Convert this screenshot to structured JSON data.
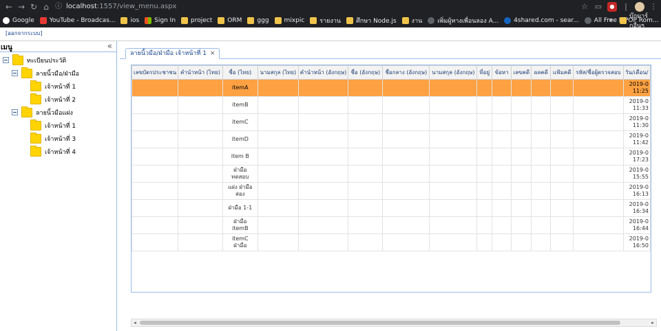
{
  "browser": {
    "url_host": "localhost",
    "url_path": ":1557/view_menu.aspx",
    "bookmarks": [
      {
        "label": "Google",
        "icon": "google-icon"
      },
      {
        "label": "YouTube - Broadcas...",
        "icon": "youtube-icon"
      },
      {
        "label": "ios",
        "icon": "folder-icon"
      },
      {
        "label": "Sign In",
        "icon": "microsoft-icon"
      },
      {
        "label": "project",
        "icon": "folder-icon"
      },
      {
        "label": "ORM",
        "icon": "folder-icon"
      },
      {
        "label": "ggg",
        "icon": "folder-icon"
      },
      {
        "label": "mixpic",
        "icon": "folder-icon"
      },
      {
        "label": "รายงาน",
        "icon": "folder-icon"
      },
      {
        "label": "ศึกษา Node.js",
        "icon": "folder-icon"
      },
      {
        "label": "งาน",
        "icon": "folder-icon"
      },
      {
        "label": "เพิ่มผู้ทางเพื่อนลอง A...",
        "icon": "globe-icon"
      },
      {
        "label": "4shared.com - sear...",
        "icon": "4shared-icon"
      },
      {
        "label": "All Free K-POP Rom...",
        "icon": "globe-icon"
      }
    ],
    "more": "»",
    "other_bookmarks": "บุ๊กมาร์กอื่นๆ"
  },
  "page": {
    "logout": "[ออกจากระบบ]",
    "west_title": "เมนู",
    "collapse": "«"
  },
  "tree": [
    {
      "label": "ทะเบียนประวัติ",
      "level": 0,
      "expander": true
    },
    {
      "label": "ลายนิ้วมือ/ฝ่ามือ",
      "level": 1,
      "expander": true
    },
    {
      "label": "เจ้าหน้าที่ 1",
      "level": 2,
      "expander": false
    },
    {
      "label": "เจ้าหน้าที่ 2",
      "level": 2,
      "expander": false
    },
    {
      "label": "ลายนิ้วมือแฝง",
      "level": 1,
      "expander": true
    },
    {
      "label": "เจ้าหน้าที่ 1",
      "level": 2,
      "expander": false
    },
    {
      "label": "เจ้าหน้าที่ 3",
      "level": 2,
      "expander": false
    },
    {
      "label": "เจ้าหน้าที่ 4",
      "level": 2,
      "expander": false
    }
  ],
  "tab": {
    "label": "ลายนิ้วมือ/ฝ่ามือ เจ้าหน้าที่ 1",
    "close": "×"
  },
  "grid": {
    "columns": [
      "เลขบัตรประชาชน",
      "คำนำหน้า (ไทย)",
      "ชื่อ (ไทย)",
      "นามสกุล (ไทย)",
      "คำนำหน้า (อังกฤษ)",
      "ชื่อ (อังกฤษ)",
      "ชื่อกลาง (อังกฤษ)",
      "นามสกุล (อังกฤษ)",
      "ที่อยู่",
      "ข้อหา",
      "เลขคดี",
      "ผลคดี",
      "แฟ้มคดี",
      "รหัส/ชื่อผู้ตรวจสอบ",
      "วัน/เดือน/"
    ],
    "rows": [
      {
        "name": "itemA",
        "date": "2019-0",
        "time": "11:25",
        "selected": true
      },
      {
        "name": "itemB",
        "date": "2019-0",
        "time": "11:33",
        "selected": false
      },
      {
        "name": "itemC",
        "date": "2019-0",
        "time": "11:30",
        "selected": false
      },
      {
        "name": "itemD",
        "date": "2019-0",
        "time": "11:42",
        "selected": false
      },
      {
        "name": "item B",
        "date": "2019-0",
        "time": "17:23",
        "selected": false
      },
      {
        "name": "ฝ่ามือ\nทดสอบ",
        "date": "2019-0",
        "time": "15:55",
        "selected": false
      },
      {
        "name": "แฝง ฝ่ามือ\nสอง",
        "date": "2019-0",
        "time": "16:13",
        "selected": false
      },
      {
        "name": "ฝ่ามือ 1-1",
        "date": "2019-0",
        "time": "16:34",
        "selected": false
      },
      {
        "name": "ฝ่ามือ\nitemB",
        "date": "2019-0",
        "time": "16:44",
        "selected": false
      },
      {
        "name": "itemC\nฝ่ามือ",
        "date": "2019-0",
        "time": "16:50",
        "selected": false
      }
    ]
  },
  "colors": {
    "selected_row": "#fda142",
    "header_text": "#1d3f72",
    "border": "#99bbe8"
  }
}
